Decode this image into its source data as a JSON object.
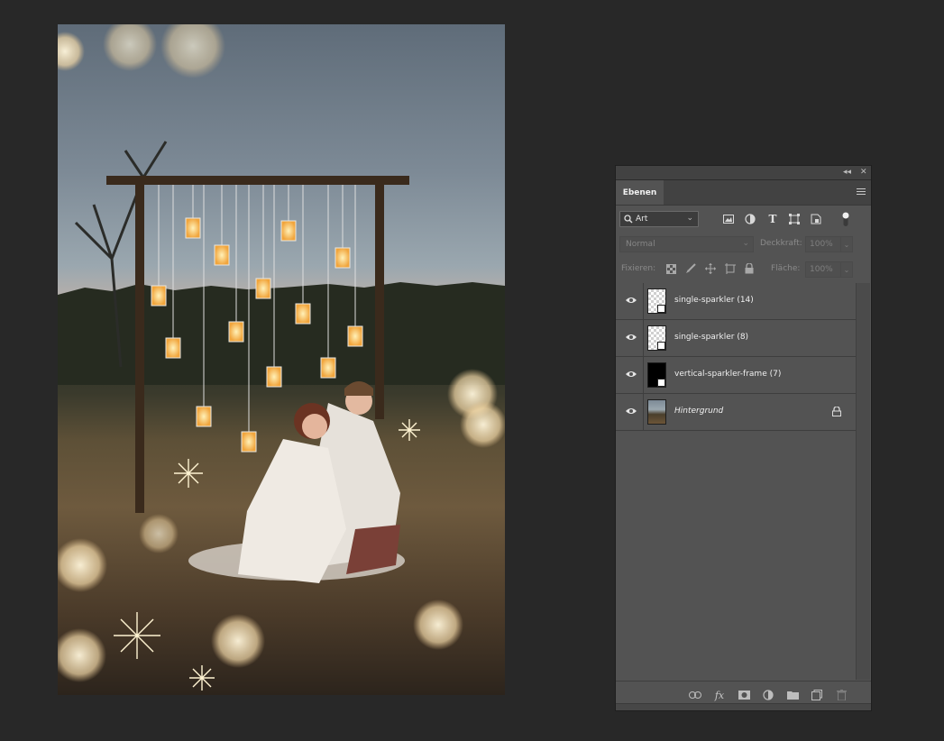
{
  "panel": {
    "collapse_label": "◂◂",
    "close_label": "✕",
    "tab_label": "Ebenen",
    "filter": {
      "kind_value": "Art"
    },
    "blend_mode": "Normal",
    "opacity_label": "Deckkraft:",
    "opacity_value": "100%",
    "lock_label": "Fixieren:",
    "fill_label": "Fläche:",
    "fill_value": "100%",
    "layers": [
      {
        "name": "single-sparkler (14)",
        "visible": true,
        "thumb": "transparent-smart"
      },
      {
        "name": "single-sparkler (8)",
        "visible": true,
        "thumb": "transparent-smart"
      },
      {
        "name": "vertical-sparkler-frame (7)",
        "visible": true,
        "thumb": "black-smart"
      },
      {
        "name": "Hintergrund",
        "visible": true,
        "thumb": "photo",
        "locked": true
      }
    ],
    "footer_icons": [
      "link-icon",
      "fx-icon",
      "mask-icon",
      "adjustment-icon",
      "folder-icon",
      "new-layer-icon",
      "trash-icon"
    ]
  },
  "colors": {
    "app_background": "#282828",
    "panel_background": "#535353"
  }
}
